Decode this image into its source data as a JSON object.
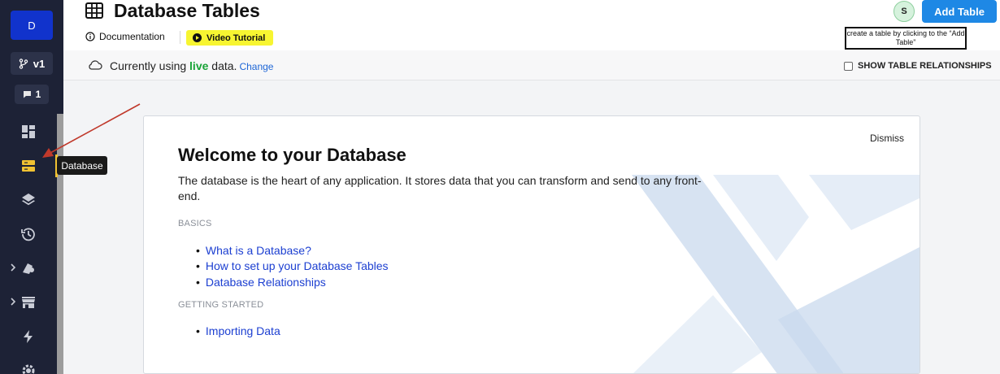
{
  "sidebar": {
    "workspace_initial": "D",
    "branch_label": "v1",
    "comment_count": "1",
    "items": [
      {
        "name": "dashboard-icon"
      },
      {
        "name": "database-icon",
        "active": true
      },
      {
        "name": "layers-icon"
      },
      {
        "name": "history-icon"
      },
      {
        "name": "plugin-icon",
        "expandable": true
      },
      {
        "name": "store-icon",
        "expandable": true
      },
      {
        "name": "lightning-icon"
      },
      {
        "name": "settings-icon"
      }
    ],
    "tooltip": "Database"
  },
  "header": {
    "title": "Database Tables",
    "documentation_label": "Documentation",
    "video_label": "Video Tutorial",
    "avatar_initial": "S",
    "add_table_label": "Add Table",
    "hint_text": "create a table by clicking to the “Add Table”"
  },
  "status": {
    "prefix": "Currently using",
    "mode": "live",
    "suffix": "data.",
    "change_label": "Change",
    "relationships_label": "SHOW TABLE RELATIONSHIPS",
    "relationships_checked": false
  },
  "welcome": {
    "dismiss_label": "Dismiss",
    "title": "Welcome to your Database",
    "description": "The database is the heart of any application. It stores data that you can transform and send to any front-end.",
    "basics_label": "BASICS",
    "basics_links": [
      "What is a Database?",
      "How to set up your Database Tables",
      "Database Relationships"
    ],
    "getting_started_label": "GETTING STARTED",
    "getting_started_links": [
      "Importing Data"
    ]
  },
  "colors": {
    "sidebar_bg": "#1d2236",
    "accent_blue": "#1e88e5",
    "live_green": "#18a336",
    "video_yellow": "#f7f531",
    "active_indicator": "#f1c232",
    "annotation_red": "#c0392b"
  }
}
